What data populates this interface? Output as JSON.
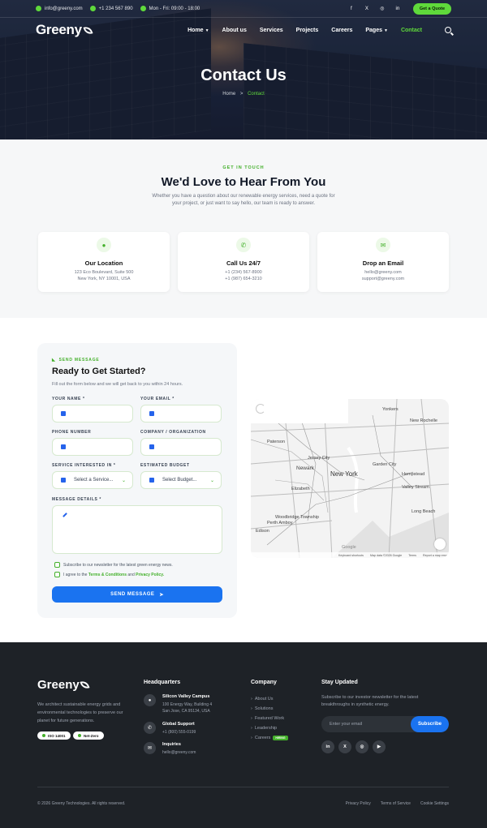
{
  "topbar": {
    "email": "info@greeny.com",
    "phone": "+1 234 567 890",
    "hours": "Mon - Fri: 09:00 - 18:00",
    "socials": [
      "f",
      "X",
      "◎",
      "in"
    ],
    "quote_label": "Get a Quote"
  },
  "nav": {
    "logo": "Greeny",
    "items": [
      "Home",
      "About us",
      "Services",
      "Projects",
      "Careers",
      "Pages",
      "Contact"
    ],
    "active": "Contact"
  },
  "hero": {
    "title": "Contact Us",
    "crumb_home": "Home",
    "crumb_sep": ">",
    "crumb_current": "Contact"
  },
  "touch": {
    "eyebrow": "GET IN TOUCH",
    "title": "We'd Love to Hear From You",
    "lead_1": "Whether you have a question about our renewable energy services, need a quote for",
    "lead_2": "your project, or just want to say hello, our team is ready to answer.",
    "cards": [
      {
        "icon": "location-pin-icon",
        "title": "Our Location",
        "line1": "123 Eco Boulevard, Suite 500",
        "line2": "New York, NY 10001, USA"
      },
      {
        "icon": "phone-icon",
        "title": "Call Us 24/7",
        "line1": "+1 (234) 567-8900",
        "line2": "+1 (987) 654-3210"
      },
      {
        "icon": "email-icon",
        "title": "Drop an Email",
        "line1": "hello@greeny.com",
        "line2": "support@greeny.com"
      }
    ]
  },
  "form": {
    "eyebrow": "SEND MESSAGE",
    "title": "Ready to Get Started?",
    "lead": "Fill out the form below and we will get back to you within 24 hours.",
    "name_label": "YOUR NAME *",
    "email_label": "YOUR EMAIL *",
    "phone_label": "PHONE NUMBER",
    "company_label": "COMPANY / ORGANIZATION",
    "service_label": "SERVICE INTERESTED IN *",
    "service_value": "Select a Service...",
    "budget_label": "ESTIMATED BUDGET",
    "budget_value": "Select Budget...",
    "message_label": "MESSAGE DETAILS *",
    "newsletter_label": "Subscribe to our newsletter for the latest green energy news.",
    "agree_pre": "I agree to the",
    "agree_terms": "Terms & Conditions",
    "agree_and": "and",
    "agree_privacy": "Privacy Policy.",
    "submit_label": "SEND MESSAGE"
  },
  "map": {
    "cities": [
      "Yonkers",
      "New Rochelle",
      "Paterson",
      "Newark",
      "New York",
      "Elizabeth",
      "Jersey City",
      "Valley Stream",
      "Long Beach",
      "Edison",
      "Perth Amboy",
      "Woodbridge Township",
      "Hempstead",
      "Garden City"
    ],
    "attribution": [
      "Keyboard shortcuts",
      "Map data ©2026 Google",
      "Terms",
      "Report a map error"
    ],
    "google": "Google"
  },
  "footer": {
    "logo": "Greeny",
    "desc": "We architect sustainable energy grids and environmental technologies to preserve our planet for future generations.",
    "badges": [
      "ISO 14001",
      "Net-Zero"
    ],
    "hq_title": "Headquarters",
    "hq": [
      {
        "title": "Silicon Valley Campus",
        "line1": "100 Energy Way, Building 4",
        "line2": "San Jose, CA 95134, USA"
      },
      {
        "title": "Global Support",
        "line1": "+1 (800) 555-0199",
        "line2": ""
      },
      {
        "title": "Inquiries",
        "line1": "hello@greeny.com",
        "line2": ""
      }
    ],
    "company_title": "Company",
    "company_links": [
      "About Us",
      "Solutions",
      "Featured Work",
      "Leadership",
      "Careers"
    ],
    "hiring_badge": "HIRING",
    "stay_title": "Stay Updated",
    "stay_desc": "Subscribe to our investor newsletter for the latest breakthroughs in synthetic energy.",
    "email_placeholder": "Enter your email",
    "subscribe_label": "Subscribe",
    "socials": [
      "in",
      "X",
      "◎",
      "▶"
    ],
    "copyright": "© 2026 Greeny Technologies. All rights reserved.",
    "legal": [
      "Privacy Policy",
      "Terms of Service",
      "Cookie Settings"
    ]
  },
  "colors": {
    "accent": "#5fd93b",
    "primary": "#1a73f0",
    "footer_bg": "#1e2227"
  }
}
